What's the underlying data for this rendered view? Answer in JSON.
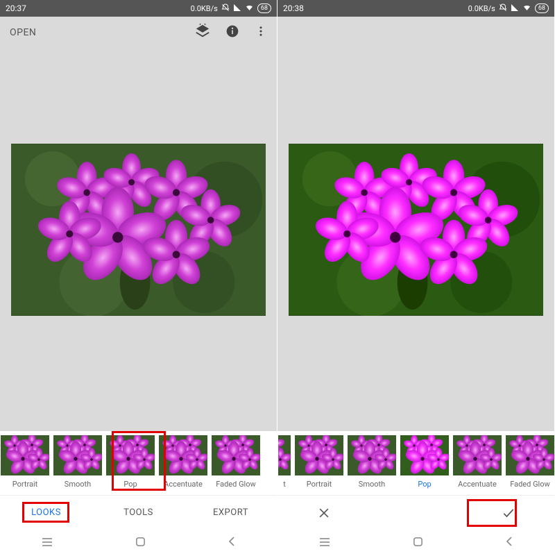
{
  "left": {
    "status": {
      "time": "20:37",
      "net": "0.0KB/s",
      "battery": "68"
    },
    "toolbar": {
      "open": "OPEN"
    },
    "thumbs": [
      {
        "label": "Portrait"
      },
      {
        "label": "Smooth"
      },
      {
        "label": "Pop"
      },
      {
        "label": "Accentuate"
      },
      {
        "label": "Faded Glow"
      }
    ],
    "tabs": {
      "looks": "LOOKS",
      "tools": "TOOLS",
      "export": "EXPORT"
    }
  },
  "right": {
    "status": {
      "time": "20:38",
      "net": "0.0KB/s",
      "battery": "68"
    },
    "thumbs": [
      {
        "label": "t"
      },
      {
        "label": "Portrait"
      },
      {
        "label": "Smooth"
      },
      {
        "label": "Pop"
      },
      {
        "label": "Accentuate"
      },
      {
        "label": "Faded Glow"
      }
    ],
    "selected_thumb": "Pop"
  }
}
